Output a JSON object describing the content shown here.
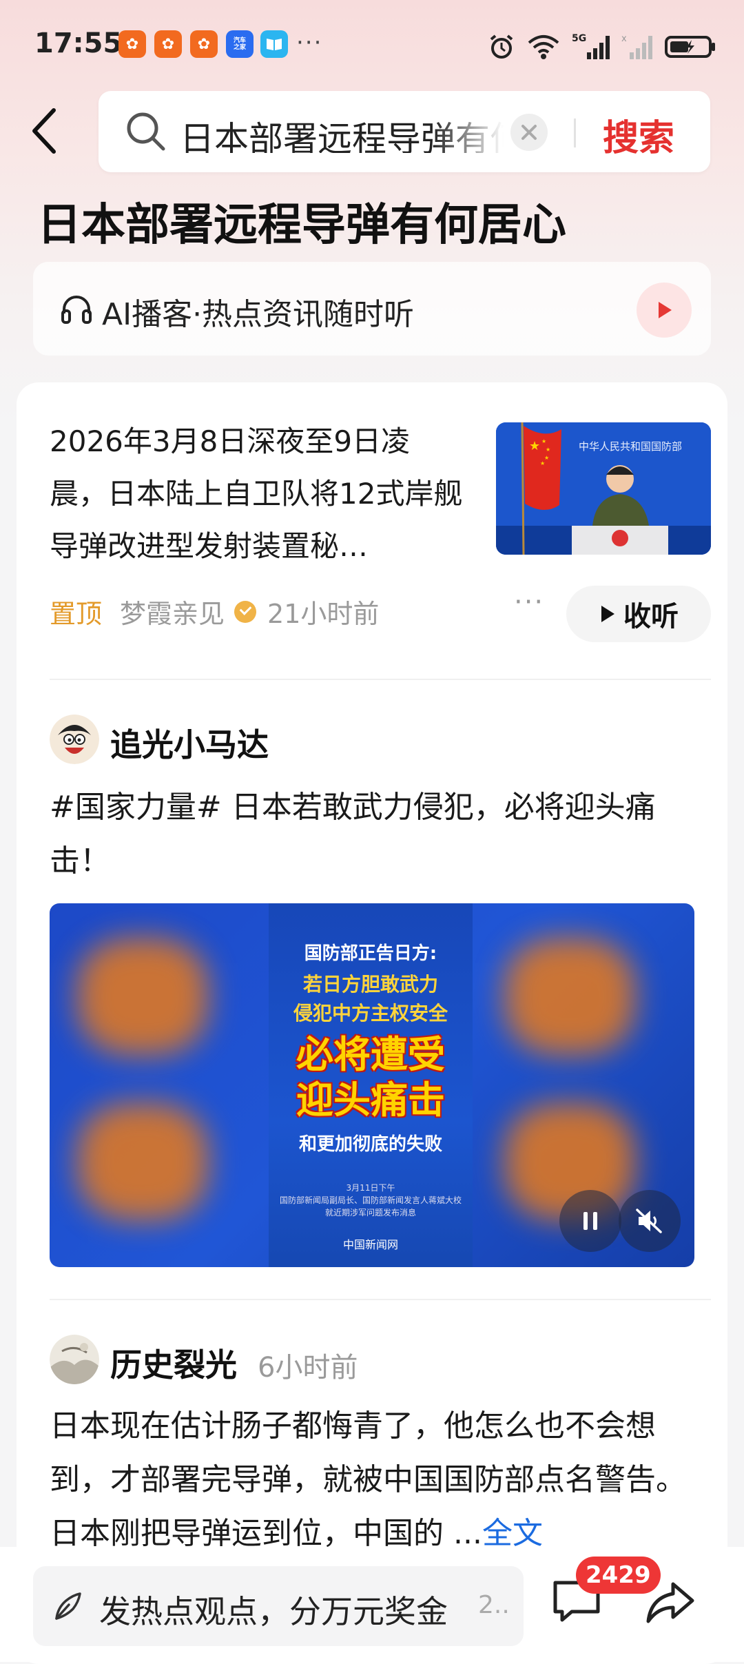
{
  "status_bar": {
    "time": "17:55",
    "apps": [
      {
        "name": "kuaishou-icon",
        "color": "#f26a1f",
        "label": "✿"
      },
      {
        "name": "kuaishou-icon-2",
        "color": "#f26a1f",
        "label": "✿"
      },
      {
        "name": "kuaishou-icon-3",
        "color": "#f26a1f",
        "label": "✿"
      },
      {
        "name": "autohome-icon",
        "color": "#2a6cf0",
        "label": "汽车之家"
      },
      {
        "name": "reader-icon",
        "color": "#2bb5f0",
        "label": "▤"
      }
    ],
    "more": "···",
    "battery_level": 0.5
  },
  "search": {
    "query": "日本部署远程导弹有何居心",
    "button": "搜索"
  },
  "page_title": "日本部署远程导弹有何居心",
  "podcast": {
    "label": "AI播客·热点资讯随时听"
  },
  "news": {
    "text": "2026年3月8日深夜至9日凌晨，日本陆上自卫队将12式岸舰导弹改进型发射装置秘…",
    "pin": "置顶",
    "source": "梦霞亲见",
    "time": "21小时前",
    "listen": "收听",
    "thumb_banner": "中华人民共和国国防部"
  },
  "post1": {
    "author": "追光小马达",
    "text": "#国家力量# 日本若敢武力侵犯，必将迎头痛击！",
    "poster": {
      "line1": "国防部正告日方:",
      "line2": "若日方胆敢武力",
      "line3": "侵犯中方主权安全",
      "line4": "必将遭受",
      "line5": "迎头痛击",
      "line6": "和更加彻底的失败",
      "line7": "3月11日下午",
      "line8": "国防部新闻局副局长、国防部新闻发言人蒋斌大校",
      "line9": "就近期涉军问题发布消息",
      "logo": "中国新闻网"
    }
  },
  "post2": {
    "author": "历史裂光",
    "time": "6小时前",
    "text": "日本现在估计肠子都悔青了，他怎么也不会想到，才部署完导弹，就被中国国防部点名警告。日本刚把导弹运到位，中国的 ...",
    "full": "全文"
  },
  "bottom": {
    "placeholder": "发热点观点，分万元奖金",
    "suffix": "2..",
    "comment_count": "2429"
  }
}
